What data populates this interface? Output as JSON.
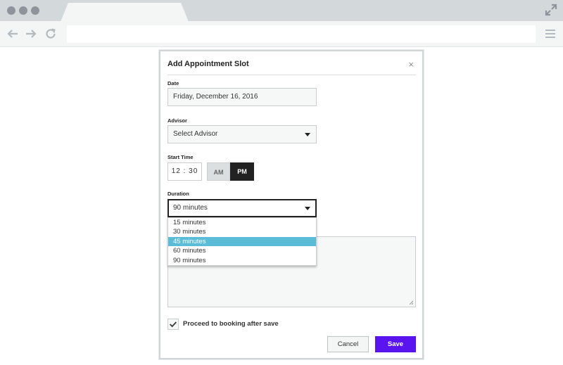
{
  "browser": {
    "icons": [
      "window-dot-icon",
      "expand-icon",
      "back-arrow-icon",
      "forward-arrow-icon",
      "reload-icon",
      "hamburger-menu-icon"
    ],
    "address_value": ""
  },
  "dialog": {
    "title": "Add Appointment Slot",
    "close_icon": "×",
    "date": {
      "label": "Date",
      "value": "Friday, December 16, 2016"
    },
    "advisor": {
      "label": "Advisor",
      "value": "Select Advisor"
    },
    "start_time": {
      "label": "Start Time",
      "value": "12 : 30",
      "am_label": "AM",
      "pm_label": "PM",
      "selected": "PM"
    },
    "duration": {
      "label": "Duration",
      "value": "90 minutes",
      "options": [
        "15 minutes",
        "30 minutes",
        "45 minutes",
        "60 minutes",
        "90 minutes"
      ],
      "highlighted_option": "45 minutes"
    },
    "notes": {
      "value": ""
    },
    "proceed_checkbox": {
      "label": "Proceed to booking after save",
      "checked": true
    },
    "cancel_label": "Cancel",
    "save_label": "Save"
  },
  "colors": {
    "accent": "#5a14f0",
    "highlight": "#5bbcd8",
    "chrome": "#d3d8db"
  }
}
